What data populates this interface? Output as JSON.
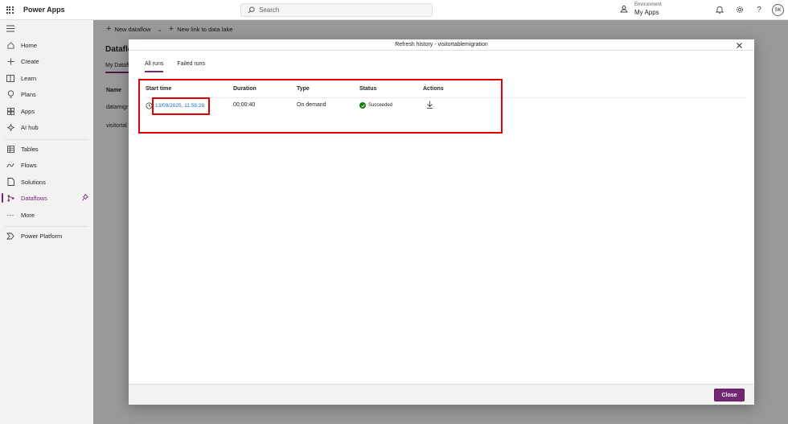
{
  "topbar": {
    "app_name": "Power Apps",
    "search_placeholder": "Search",
    "environment_label": "Environment",
    "environment_value": "My Apps",
    "avatar_initials": "SK"
  },
  "sidebar": {
    "items": [
      {
        "label": "Home",
        "icon": "home-icon"
      },
      {
        "label": "Create",
        "icon": "plus-icon"
      },
      {
        "label": "Learn",
        "icon": "book-icon"
      },
      {
        "label": "Plans",
        "icon": "lightbulb-icon"
      },
      {
        "label": "Apps",
        "icon": "apps-icon"
      },
      {
        "label": "AI hub",
        "icon": "ai-hub-icon"
      },
      {
        "label": "Tables",
        "icon": "table-icon"
      },
      {
        "label": "Flows",
        "icon": "flow-icon"
      },
      {
        "label": "Solutions",
        "icon": "solutions-icon"
      },
      {
        "label": "Dataflows",
        "icon": "dataflow-icon"
      },
      {
        "label": "More",
        "icon": "ellipsis-icon"
      },
      {
        "label": "Power Platform",
        "icon": "power-platform-icon"
      }
    ],
    "active": "Dataflows"
  },
  "main": {
    "commands": [
      "New dataflow",
      "New link to data lake"
    ],
    "page_title": "Dataflo",
    "tab_label": "My Datafl",
    "column_name": "Name",
    "rows": [
      "datamigr",
      "visitortal"
    ]
  },
  "dialog": {
    "title": "Refresh history - visitortablemigration",
    "tabs": [
      "All runs",
      "Failed runs"
    ],
    "active_tab": "All runs",
    "columns": [
      "Start time",
      "Duration",
      "Type",
      "Status",
      "Actions"
    ],
    "rows": [
      {
        "start_time": "13/09/2025, 11:59:28",
        "duration": "00:00:40",
        "type": "On demand",
        "status": "Succeeded"
      }
    ],
    "close_label": "Close"
  },
  "colors": {
    "accent": "#742774",
    "link": "#0f6cbd",
    "success": "#107c10",
    "highlight": "#e00000"
  }
}
